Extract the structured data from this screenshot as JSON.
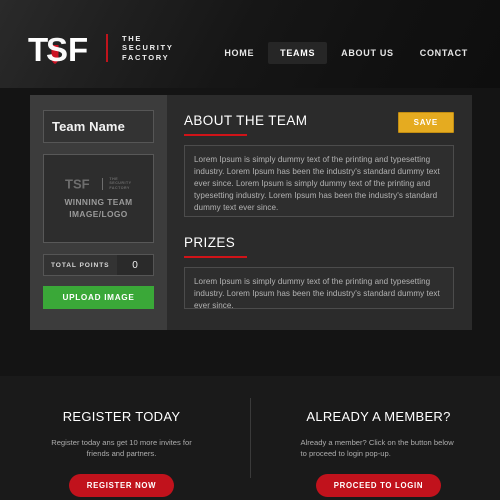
{
  "brand": {
    "logo_text": "TSF",
    "tagline_line1": "THE",
    "tagline_line2": "SECURITY",
    "tagline_line3": "FACTORY",
    "accent_red": "#c0141c"
  },
  "nav": {
    "items": [
      {
        "label": "HOME",
        "active": false
      },
      {
        "label": "TEAMS",
        "active": true
      },
      {
        "label": "ABOUT US",
        "active": false
      },
      {
        "label": "CONTACT",
        "active": false
      }
    ]
  },
  "team_panel": {
    "team_name_value": "Team Name",
    "team_name_placeholder": "Team Name",
    "image_placeholder": {
      "logo_text": "TSF",
      "tagline_line1": "THE",
      "tagline_line2": "SECURITY",
      "tagline_line3": "FACTORY",
      "caption_line1": "WINNING TEAM",
      "caption_line2": "IMAGE/LOGO"
    },
    "total_points_label": "TOTAL POINTS",
    "total_points_value": "0",
    "upload_label": "UPLOAD IMAGE",
    "upload_color": "#3aa838"
  },
  "about": {
    "title": "ABOUT THE TEAM",
    "save_label": "SAVE",
    "save_color": "#e5ab20",
    "body": "Lorem Ipsum is simply dummy text of the printing and typesetting industry. Lorem Ipsum has been the industry's standard dummy text ever since. Lorem Ipsum is simply dummy text of the printing and typesetting industry. Lorem Ipsum has been the industry's standard dummy text ever since."
  },
  "prizes": {
    "title": "PRIZES",
    "body": "Lorem Ipsum is simply dummy text of the printing and typesetting industry. Lorem Ipsum has been the industry's standard dummy text ever since."
  },
  "footer": {
    "register": {
      "title": "REGISTER TODAY",
      "text": "Register today ans get 10 more invites for friends and partners.",
      "button_label": "REGISTER NOW"
    },
    "member": {
      "title": "ALREADY A MEMBER?",
      "text": "Already a member? Click on the button below to proceed to login pop-up.",
      "button_label": "PROCEED TO LOGIN"
    },
    "button_color": "#c1121c"
  }
}
